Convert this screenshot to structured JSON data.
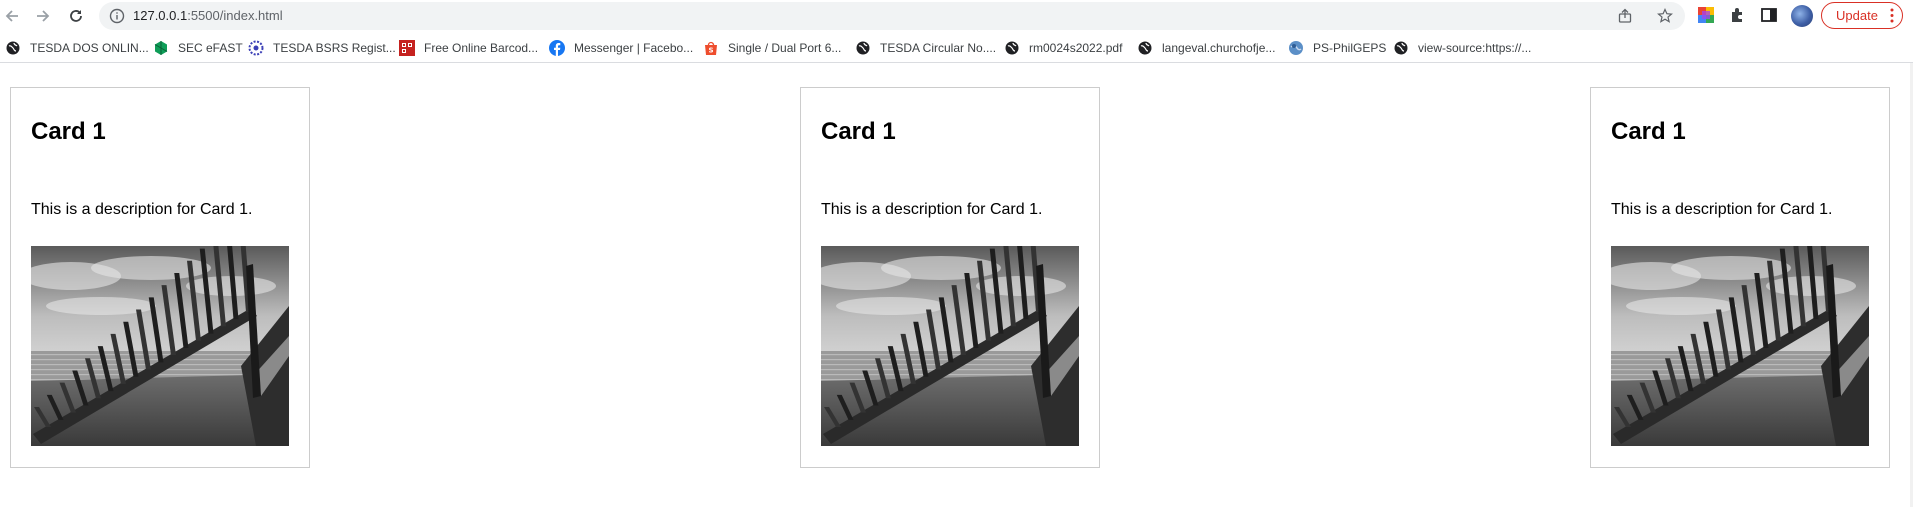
{
  "browser": {
    "url_host": "127.0.0.1",
    "url_rest": ":5500/index.html",
    "update_label": "Update"
  },
  "bookmarks": [
    {
      "label": "TESDA DOS ONLIN...",
      "icon": "globe-icon"
    },
    {
      "label": "SEC eFAST",
      "icon": "sec-efast-icon"
    },
    {
      "label": "TESDA BSRS Regist...",
      "icon": "bsrs-icon"
    },
    {
      "label": "Free Online Barcod...",
      "icon": "barcode-icon"
    },
    {
      "label": "Messenger | Facebo...",
      "icon": "facebook-icon"
    },
    {
      "label": "Single / Dual Port 6...",
      "icon": "shopee-icon"
    },
    {
      "label": "TESDA Circular No....",
      "icon": "globe-icon"
    },
    {
      "label": "rm0024s2022.pdf",
      "icon": "globe-icon"
    },
    {
      "label": "langeval.churchofje...",
      "icon": "globe-icon"
    },
    {
      "label": "PS-PhilGEPS",
      "icon": "philgeps-icon"
    },
    {
      "label": "view-source:https://...",
      "icon": "globe-icon"
    }
  ],
  "cards": [
    {
      "title": "Card 1",
      "description": "This is a description for Card 1.",
      "image": "shipwreck-photo"
    },
    {
      "title": "Card 1",
      "description": "This is a description for Card 1.",
      "image": "shipwreck-photo"
    },
    {
      "title": "Card 1",
      "description": "This is a description for Card 1.",
      "image": "shipwreck-photo"
    }
  ]
}
